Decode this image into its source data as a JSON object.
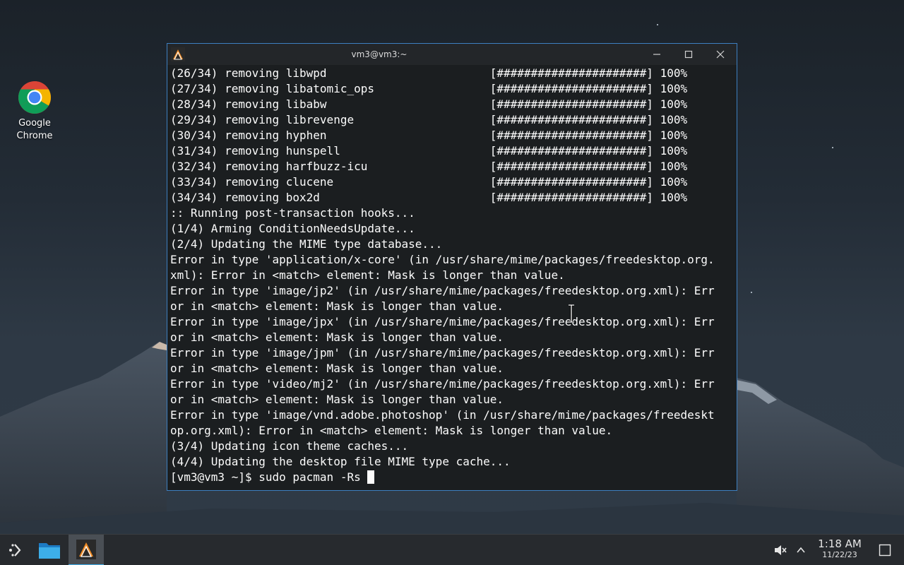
{
  "desktop": {
    "icons": [
      {
        "label": "Google Chrome",
        "icon": "chrome-icon"
      }
    ]
  },
  "window": {
    "title": "vm3@vm3:~",
    "app_icon": "konsole-icon",
    "controls": [
      "minimize-icon",
      "maximize-icon",
      "close-icon"
    ]
  },
  "terminal": {
    "lines": [
      "(26/34) removing libwpd                        [######################] 100%",
      "(27/34) removing libatomic_ops                 [######################] 100%",
      "(28/34) removing libabw                        [######################] 100%",
      "(29/34) removing librevenge                    [######################] 100%",
      "(30/34) removing hyphen                        [######################] 100%",
      "(31/34) removing hunspell                      [######################] 100%",
      "(32/34) removing harfbuzz-icu                  [######################] 100%",
      "(33/34) removing clucene                       [######################] 100%",
      "(34/34) removing box2d                         [######################] 100%",
      ":: Running post-transaction hooks...",
      "(1/4) Arming ConditionNeedsUpdate...",
      "(2/4) Updating the MIME type database...",
      "Error in type 'application/x-core' (in /usr/share/mime/packages/freedesktop.org.",
      "xml): Error in <match> element: Mask is longer than value.",
      "Error in type 'image/jp2' (in /usr/share/mime/packages/freedesktop.org.xml): Err",
      "or in <match> element: Mask is longer than value.",
      "Error in type 'image/jpx' (in /usr/share/mime/packages/freedesktop.org.xml): Err",
      "or in <match> element: Mask is longer than value.",
      "Error in type 'image/jpm' (in /usr/share/mime/packages/freedesktop.org.xml): Err",
      "or in <match> element: Mask is longer than value.",
      "Error in type 'video/mj2' (in /usr/share/mime/packages/freedesktop.org.xml): Err",
      "or in <match> element: Mask is longer than value.",
      "Error in type 'image/vnd.adobe.photoshop' (in /usr/share/mime/packages/freedeskt",
      "op.org.xml): Error in <match> element: Mask is longer than value.",
      "(3/4) Updating icon theme caches...",
      "(4/4) Updating the desktop file MIME type cache..."
    ],
    "prompt": "[vm3@vm3 ~]$ sudo pacman -Rs "
  },
  "taskbar": {
    "items": [
      "launcher-icon",
      "file-manager-icon",
      "terminal-icon"
    ],
    "tray": [
      "volume-muted-icon",
      "chevron-up-icon"
    ],
    "clock": {
      "time": "1:18 AM",
      "date": "11/22/23"
    },
    "show_desktop_icon": "show-desktop-icon"
  },
  "colors": {
    "terminal_bg": "#1b1e20",
    "terminal_fg": "#fcfcfc",
    "window_border": "#3d7fc0",
    "taskbar_bg": "#272a2e",
    "accent": "#3daee9"
  }
}
